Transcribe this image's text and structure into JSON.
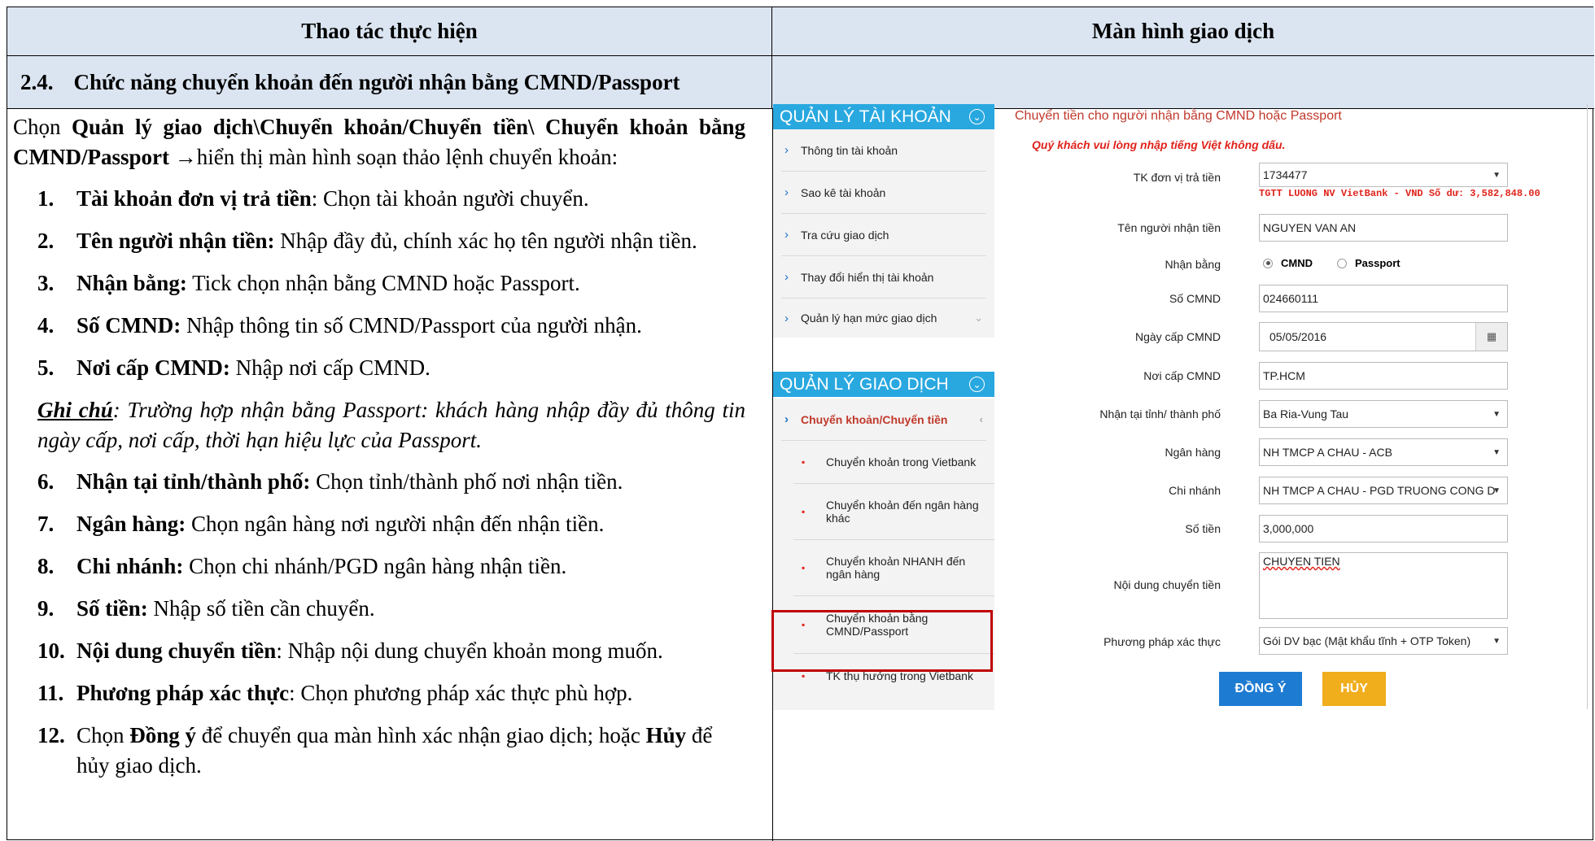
{
  "table": {
    "col_left_header": "Thao tác thực hiện",
    "col_right_header": "Màn hình giao dịch",
    "section_number": "2.4.",
    "section_title": "Chức năng chuyển khoản đến người nhận bằng CMND/Passport"
  },
  "instructions": {
    "intro_prefix": "Chọn ",
    "intro_bold": "Quản lý giao dịch\\Chuyển khoản/Chuyển tiền\\ Chuyển khoản bằng CMND/Passport",
    "intro_suffix": " →hiển thị màn hình soạn thảo lệnh chuyển khoản:",
    "steps_a": [
      {
        "num": "1.",
        "bold": "Tài khoản đơn vị trả tiền",
        "text": ": Chọn tài khoản người chuyển."
      },
      {
        "num": "2.",
        "bold": "Tên người nhận tiền:",
        "text": " Nhập đầy đủ, chính xác họ tên người nhận tiền."
      },
      {
        "num": "3.",
        "bold": "Nhận bằng:",
        "text": " Tick chọn nhận bằng CMND hoặc Passport."
      },
      {
        "num": "4.",
        "bold": "Số CMND:",
        "text": " Nhập thông tin số CMND/Passport của người nhận."
      },
      {
        "num": "5.",
        "bold": "Nơi cấp CMND:",
        "text": " Nhập nơi cấp CMND."
      }
    ],
    "note_label": "Ghi chú",
    "note_text": ": Trường hợp nhận bằng Passport: khách hàng nhập đầy đủ thông tin ngày cấp, nơi cấp, thời hạn hiệu lực của Passport.",
    "steps_b": [
      {
        "num": "6.",
        "bold": "Nhận tại tỉnh/thành phố:",
        "text": " Chọn tỉnh/thành phố nơi nhận tiền."
      },
      {
        "num": "7.",
        "bold": "Ngân hàng:",
        "text": " Chọn ngân hàng nơi người nhận đến nhận tiền."
      },
      {
        "num": "8.",
        "bold": "Chi nhánh:",
        "text": " Chọn chi nhánh/PGD ngân hàng nhận tiền."
      },
      {
        "num": "9.",
        "bold": "Số tiền:",
        "text": " Nhập số tiền cần chuyển."
      },
      {
        "num": "10.",
        "bold": "Nội dung chuyển tiền",
        "text": ": Nhập nội dung chuyển khoản mong muốn."
      },
      {
        "num": "11.",
        "bold": "Phương pháp xác thực",
        "text": ": Chọn phương pháp xác thực phù hợp."
      }
    ],
    "step12": {
      "num": "12.",
      "pre": "Chọn ",
      "bold1": "Đồng ý",
      "mid": " để chuyển qua màn hình xác nhận giao dịch; hoặc ",
      "bold2": "Hủy",
      "post": " để hủy giao dịch."
    }
  },
  "sidebar": {
    "account_header": "QUẢN LÝ TÀI KHOẢN",
    "account_items": [
      "Thông tin tài khoản",
      "Sao kê tài khoản",
      "Tra cứu giao dịch",
      "Thay đổi hiển thị tài khoản",
      "Quản lý hạn mức giao dịch"
    ],
    "transaction_header": "QUẢN LÝ GIAO DỊCH",
    "transfer_group": "Chuyển khoản/Chuyển tiền",
    "transfer_items": [
      "Chuyển khoản trong Vietbank",
      "Chuyển khoản đến ngân hàng khác",
      "Chuyển khoản NHANH đến ngân hàng",
      "Chuyển khoản bằng CMND/Passport",
      "TK thụ hưởng trong Vietbank"
    ]
  },
  "form": {
    "title": "Chuyển tiền cho người nhận bằng CMND hoặc Passport",
    "warning": "Quý khách vui lòng nhập tiếng Việt không dấu.",
    "payer_account_label": "TK đơn vị trả tiền",
    "payer_account_value": "1734477",
    "payer_account_info": "TGTT LUONG NV VietBank - VND  Số dư: 3,582,848.00",
    "recipient_name_label": "Tên người nhận tiền",
    "recipient_name_value": "NGUYEN VAN AN",
    "receive_by_label": "Nhận bằng",
    "receive_by_options": [
      "CMND",
      "Passport"
    ],
    "receive_by_selected": "CMND",
    "id_number_label": "Số CMND",
    "id_number_value": "024660111",
    "issue_date_label": "Ngày cấp CMND",
    "issue_date_value": "05/05/2016",
    "issue_place_label": "Nơi cấp CMND",
    "issue_place_value": "TP.HCM",
    "province_label": "Nhận tại tỉnh/ thành phố",
    "province_value": "Ba Ria-Vung Tau",
    "bank_label": "Ngân hàng",
    "bank_value": "NH TMCP A CHAU - ACB",
    "branch_label": "Chi nhánh",
    "branch_value": "NH TMCP A CHAU - PGD TRUONG CONG D",
    "amount_label": "Số tiền",
    "amount_value": "3,000,000",
    "content_label": "Nội dung chuyển tiền",
    "content_value": "CHUYEN TIEN",
    "auth_label": "Phương pháp xác thực",
    "auth_value": "Gói DV bạc (Mật khẩu tĩnh + OTP Token)",
    "agree_button": "ĐỒNG Ý",
    "cancel_button": "HỦY"
  },
  "colors": {
    "header_bg": "#dbe5f1",
    "sidebar_header": "#29a8e0",
    "agree": "#1e7bd2",
    "cancel": "#f0ad1c",
    "highlight": "#c00000"
  }
}
